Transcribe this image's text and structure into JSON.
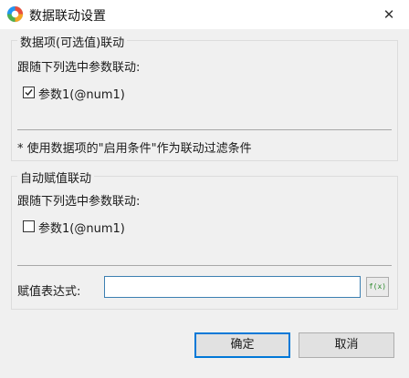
{
  "window": {
    "title": "数据联动设置",
    "close_glyph": "✕",
    "app_icon": "app-logo-icon"
  },
  "section1": {
    "legend": "数据项(可选值)联动",
    "sub_label": "跟随下列选中参数联动:",
    "params": [
      {
        "label": "参数1(@num1)",
        "checked": true
      }
    ],
    "note": "* 使用数据项的\"启用条件\"作为联动过滤条件"
  },
  "section2": {
    "legend": "自动赋值联动",
    "sub_label": "跟随下列选中参数联动:",
    "params": [
      {
        "label": "参数1(@num1)",
        "checked": false
      }
    ],
    "expr_label": "赋值表达式:",
    "expr_value": "",
    "fx_label": "f(x)"
  },
  "buttons": {
    "ok": "确定",
    "cancel": "取消"
  },
  "colors": {
    "accent": "#0078d7",
    "fx_green": "#2e8b2e"
  }
}
